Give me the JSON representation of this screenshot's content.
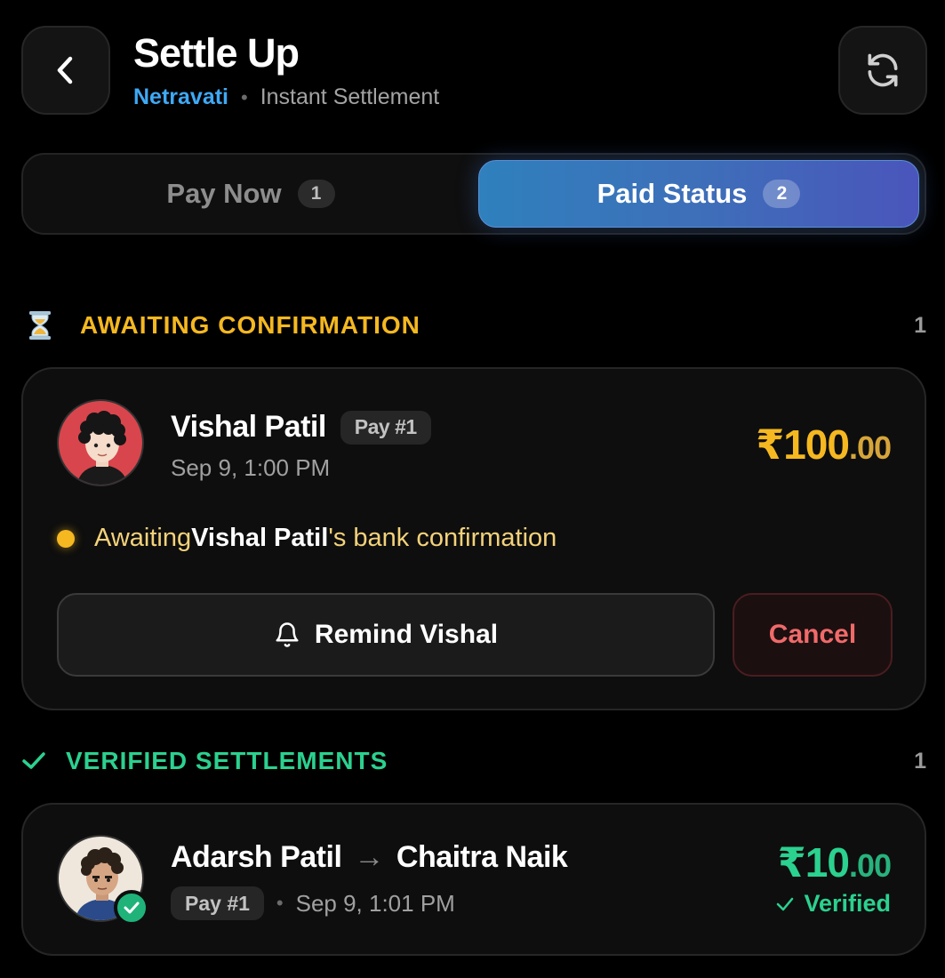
{
  "header": {
    "title": "Settle Up",
    "group_name": "Netravati",
    "separator": "•",
    "settlement_type": "Instant Settlement",
    "back_icon": "chevron-left-icon",
    "refresh_icon": "refresh-icon"
  },
  "tabs": [
    {
      "label": "Pay Now",
      "count": "1",
      "active": false
    },
    {
      "label": "Paid Status",
      "count": "2",
      "active": true
    }
  ],
  "sections": {
    "awaiting": {
      "icon": "hourglass-icon",
      "title": "AWAITING CONFIRMATION",
      "count": "1",
      "color": "#f5b820"
    },
    "verified": {
      "icon": "check-icon",
      "title": "VERIFIED SETTLEMENTS",
      "count": "1",
      "color": "#2bd18f"
    }
  },
  "awaiting_card": {
    "name": "Vishal Patil",
    "pay_tag": "Pay #1",
    "time": "Sep 9, 1:00 PM",
    "amount_main": "₹100",
    "amount_cents": ".00",
    "status_prefix": "Awaiting ",
    "status_name": "Vishal Patil",
    "status_suffix": "'s bank confirmation",
    "remind_label": "Remind Vishal",
    "remind_icon": "bell-icon",
    "cancel_label": "Cancel"
  },
  "verified_card": {
    "from": "Adarsh Patil",
    "arrow": "→",
    "to": "Chaitra Naik",
    "pay_tag": "Pay #1",
    "separator": "•",
    "time": "Sep 9, 1:01 PM",
    "amount_main": "₹10",
    "amount_cents": ".00",
    "verified_label": "Verified"
  }
}
